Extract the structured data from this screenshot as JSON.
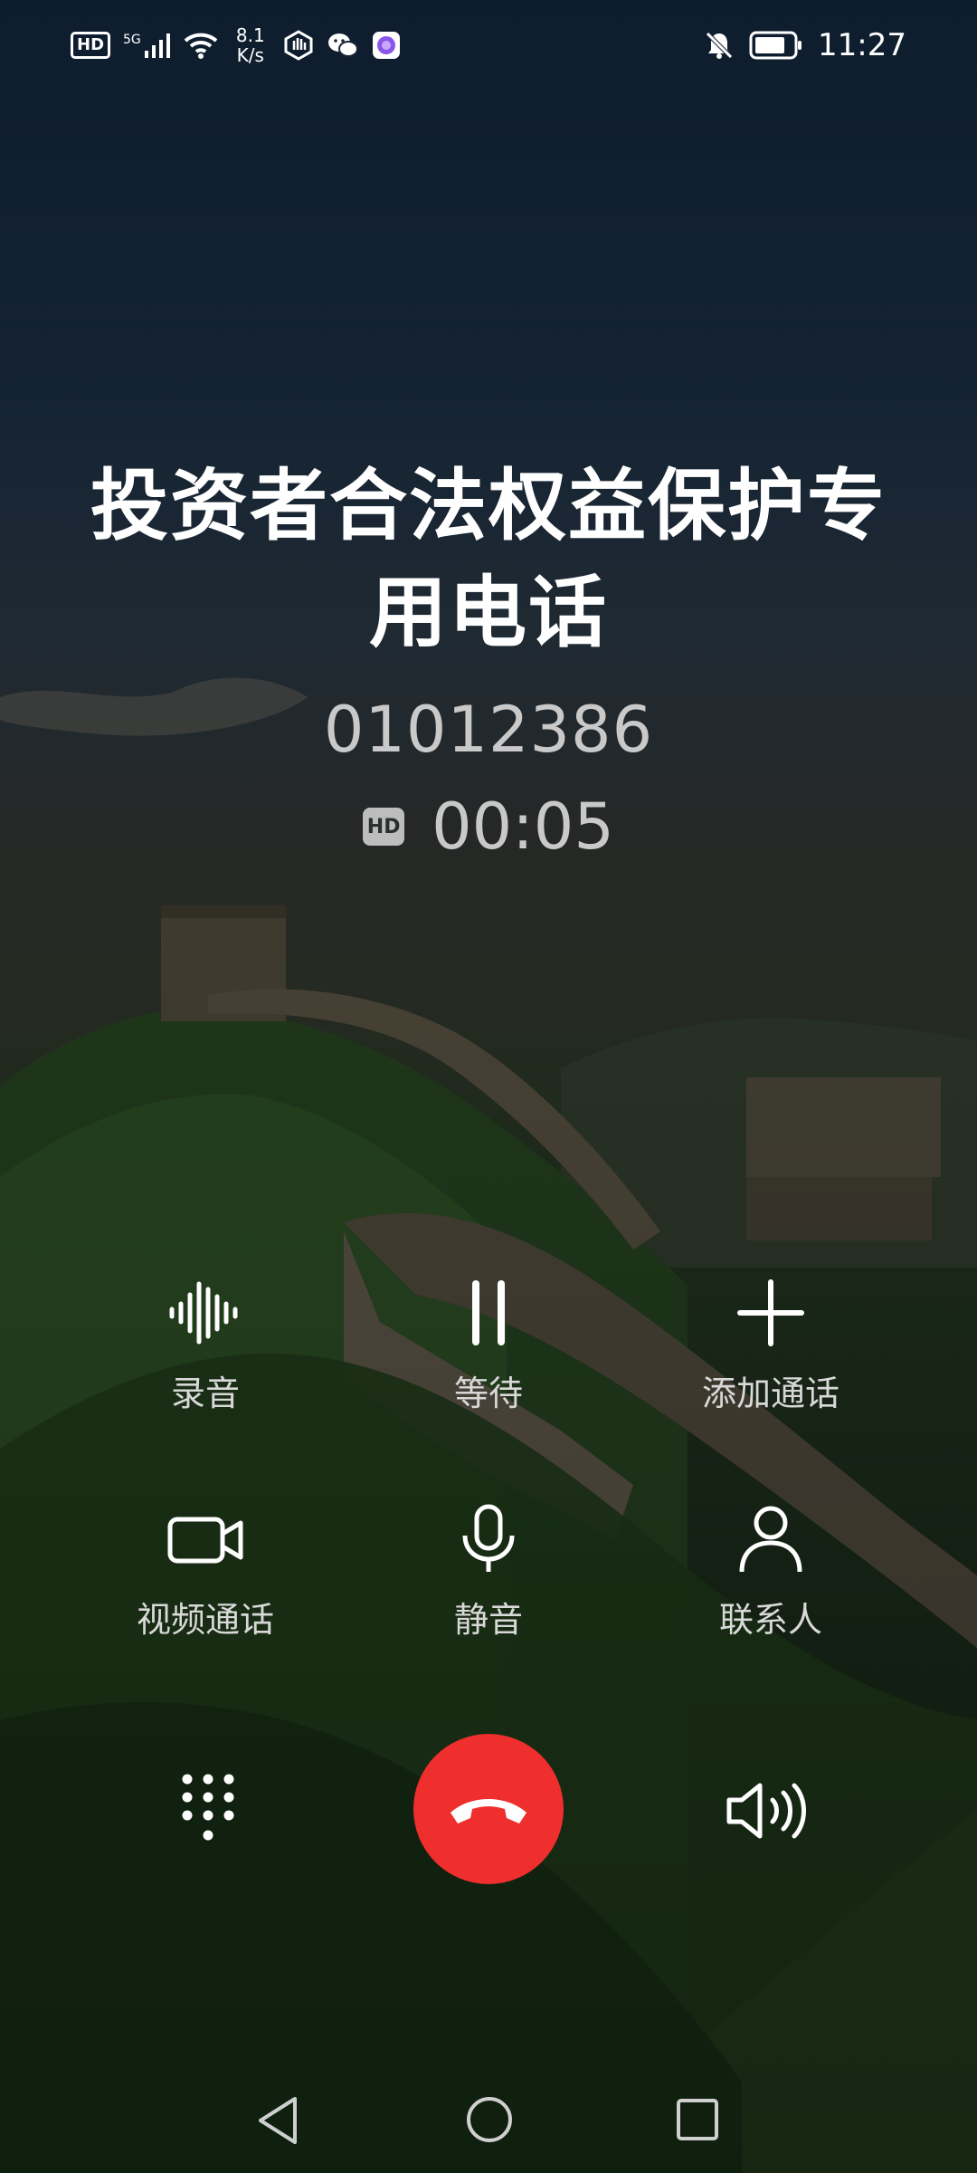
{
  "status_bar": {
    "hd": "HD",
    "network": "5G",
    "speed_value": "8.1",
    "speed_unit": "K/s",
    "time": "11:27"
  },
  "call": {
    "name": "投资者合法权益保护专用电话",
    "number": "01012386",
    "hd_badge": "HD",
    "duration": "00:05"
  },
  "actions": {
    "record": "录音",
    "hold": "等待",
    "add_call": "添加通话",
    "video_call": "视频通话",
    "mute": "静音",
    "contacts": "联系人"
  },
  "colors": {
    "end_call": "#ef2e2e",
    "label": "#d8d8d8",
    "secondary_text": "#c9c9c9"
  },
  "icons": {
    "record": "waveform-icon",
    "hold": "pause-icon",
    "add_call": "plus-icon",
    "video_call": "video-camera-icon",
    "mute": "microphone-icon",
    "contacts": "person-icon",
    "dialpad": "dialpad-icon",
    "end_call": "hang-up-icon",
    "speaker": "speaker-icon"
  }
}
